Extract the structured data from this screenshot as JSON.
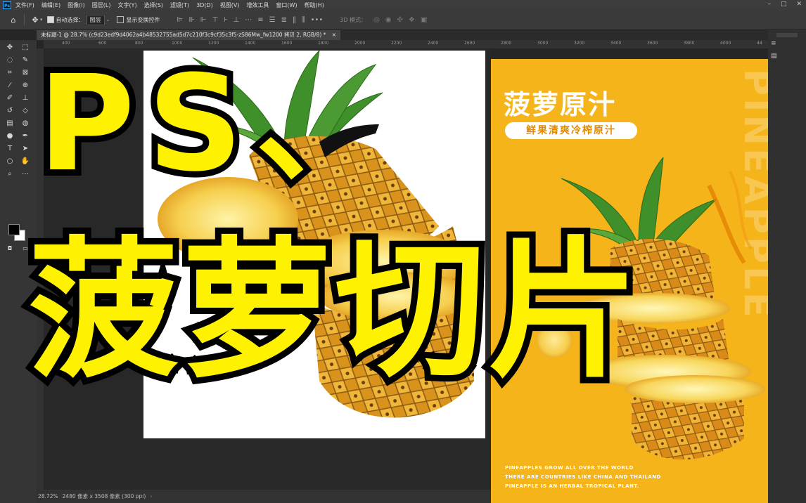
{
  "app": {
    "logo": "Ps"
  },
  "menu": [
    "文件(F)",
    "编辑(E)",
    "图像(I)",
    "图层(L)",
    "文字(Y)",
    "选择(S)",
    "滤镜(T)",
    "3D(D)",
    "视图(V)",
    "增效工具",
    "窗口(W)",
    "帮助(H)"
  ],
  "options": {
    "auto_select_label": "自动选择：",
    "auto_select_value": "图层",
    "show_transform_label": "显示变换控件",
    "mode_3d_label": "3D 模式："
  },
  "tab": {
    "title": "未标题-1 @ 28.7% (c9d23edf9d4062a4b48532755ad5d7c210f3c9cf35c3f5-zS86Mw_fw1200 拷贝 2, RGB/8) *",
    "close": "×"
  },
  "ruler_ticks": [
    "400",
    "600",
    "800",
    "1000",
    "1200",
    "1400",
    "1600",
    "1800",
    "2000",
    "2200",
    "2400",
    "2600",
    "2800",
    "3000",
    "3200",
    "3400",
    "3600",
    "3800",
    "4000",
    "44"
  ],
  "status": {
    "zoom": "28.72%",
    "size": "2480 像素 x 3508 像素 (300 ppi)"
  },
  "poster": {
    "title": "菠萝原汁",
    "subtitle": "鲜果清爽冷榨原汁",
    "vertical_text": "PINEAPPLE",
    "lines": [
      "PINEAPPLES GROW ALL OVER THE WORLD",
      "THERE ARE COUNTRIES LIKE CHINA AND THAILAND",
      "PINEAPPLE IS AN HERBAL TROPICAL PLANT."
    ]
  },
  "overlay": {
    "line1": "PS、",
    "line2": "菠萝切片"
  }
}
